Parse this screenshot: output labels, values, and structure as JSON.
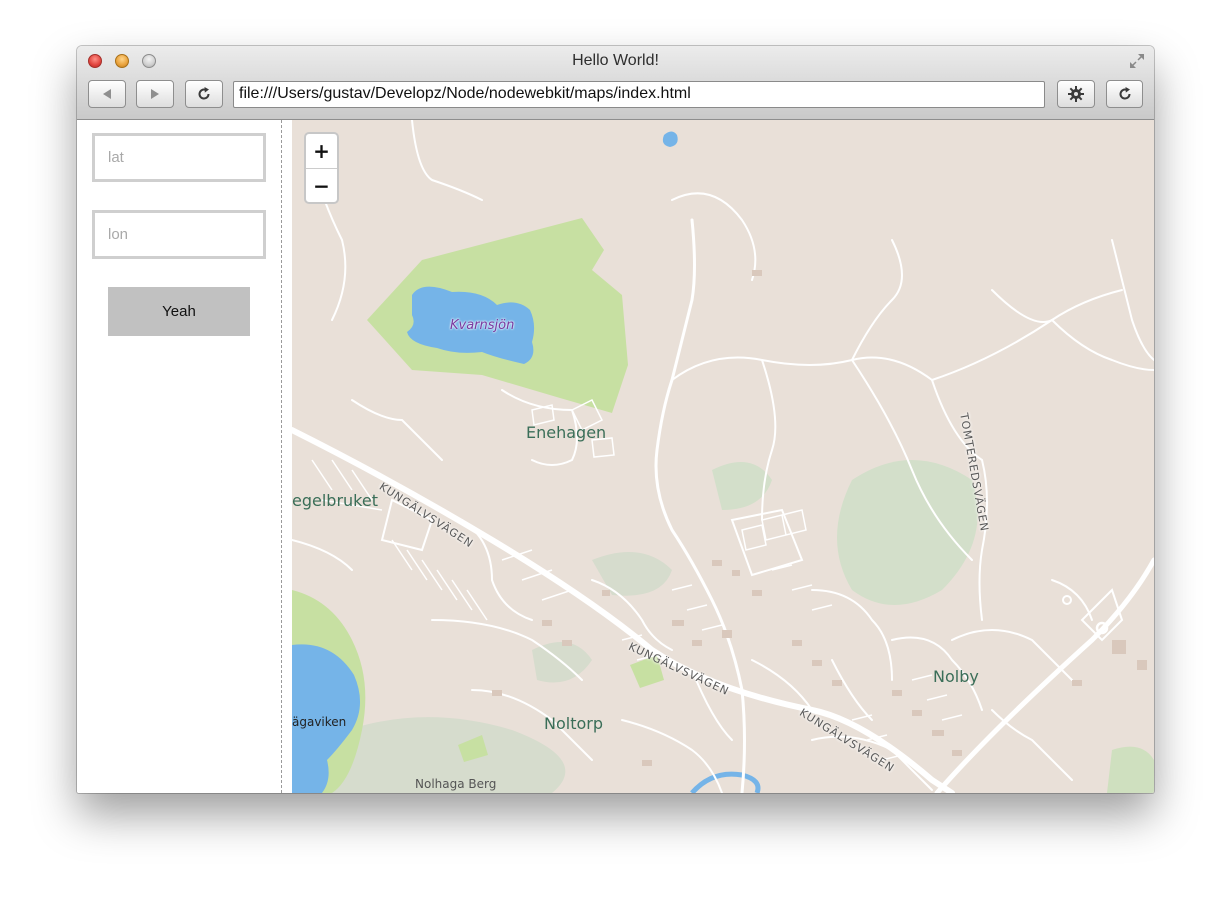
{
  "window": {
    "title": "Hello World!",
    "url": "file:///Users/gustav/Developz/Node/nodewebkit/maps/index.html",
    "icons": {
      "close": "close-icon",
      "minimize": "minimize-icon",
      "zoom": "zoom-icon",
      "fullscreen": "fullscreen-icon",
      "back": "back-arrow-icon",
      "forward": "forward-arrow-icon",
      "reload": "reload-icon",
      "settings": "gear-icon"
    }
  },
  "sidebar": {
    "lat_placeholder": "lat",
    "lat_value": "",
    "lon_placeholder": "lon",
    "lon_value": "",
    "button_label": "Yeah"
  },
  "map": {
    "zoom_in": "+",
    "zoom_out": "−",
    "labels": {
      "kvarnsjon": "Kvarnsjön",
      "enehagen": "Enehagen",
      "tegelbruket": "egelbruket",
      "kungalvsvagen_1": "KUNGÄLVSVÄGEN",
      "kungalvsvagen_2": "KUNGÄLVSVÄGEN",
      "kungalvsvagen_3": "KUNGÄLVSVÄGEN",
      "tomteredsvagen": "TOMTEREDSVÄGEN",
      "nolby": "Nolby",
      "noltorp": "Noltorp",
      "nolhagaviken": "ägaviken",
      "nolhaga_berg": "Nolhaga Berg"
    },
    "colors": {
      "land": "#e9e0d8",
      "water": "#75b4e8",
      "park": "#c9e1a4",
      "forest": "#d4dccb",
      "road": "#ffffff"
    }
  }
}
